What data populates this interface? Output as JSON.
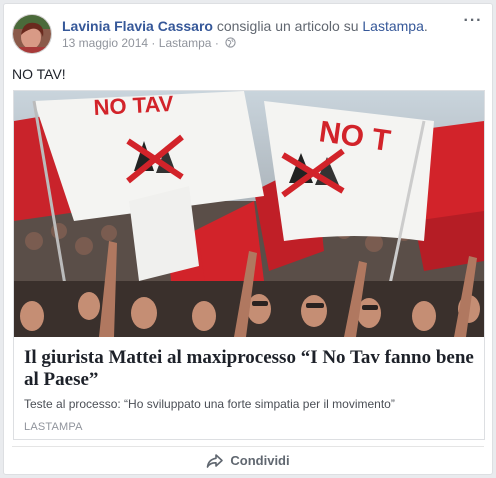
{
  "post": {
    "author": "Lavinia Flavia Cassaro",
    "action": "consiglia un articolo su",
    "action_target": "Lastampa",
    "action_end": ".",
    "date": "13 maggio 2014",
    "separator": "·",
    "source": "Lastampa",
    "privacy_icon": "globe-icon",
    "more_icon": "more-options-icon",
    "message": "NO TAV!"
  },
  "link_card": {
    "title": "Il giurista Mattei al maxiprocesso “I No Tav fanno bene al Paese”",
    "description": "Teste al processo: “Ho sviluppato una forte simpatia per il movimento”",
    "source": "LASTAMPA",
    "photo_flag_text": "NO TAV",
    "photo_flag_text_2": "NO TAV"
  },
  "actions": {
    "share_label": "Condividi",
    "share_icon": "share-arrow-icon"
  },
  "colors": {
    "link": "#365899",
    "flag_red": "#d2232a",
    "flag_white": "#f4f4f2"
  }
}
